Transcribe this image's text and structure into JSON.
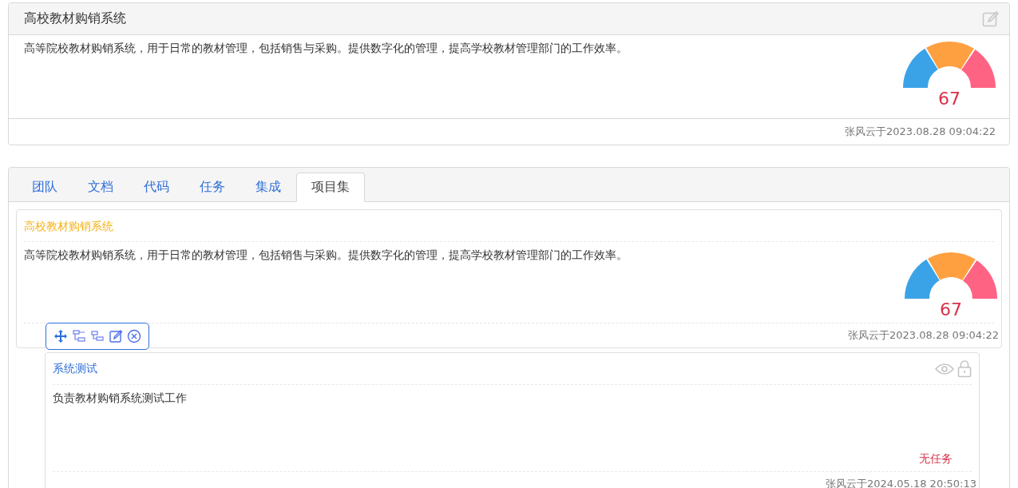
{
  "project": {
    "title": "高校教材购销系统",
    "description": "高等院校教材购销系统，用于日常的教材管理，包括销售与采购。提供数字化的管理，提高学校教材管理部门的工作效率。",
    "score": "67",
    "footer": "张风云于2023.08.28 09:04:22"
  },
  "tabs": [
    {
      "label": "团队",
      "selected": false
    },
    {
      "label": "文档",
      "selected": false
    },
    {
      "label": "代码",
      "selected": false
    },
    {
      "label": "任务",
      "selected": false
    },
    {
      "label": "集成",
      "selected": false
    },
    {
      "label": "项目集",
      "selected": true
    }
  ],
  "project_card": {
    "title": "高校教材购销系统",
    "description": "高等院校教材购销系统，用于日常的教材管理，包括销售与采购。提供数字化的管理，提高学校教材管理部门的工作效率。",
    "score": "67",
    "footer": "张风云于2023.08.28 09:04:22"
  },
  "subproject": {
    "title": "系统测试",
    "description": "负责教材购销系统测试工作",
    "status": "无任务",
    "footer": "张风云于2024.05.18 20:50:13"
  }
}
